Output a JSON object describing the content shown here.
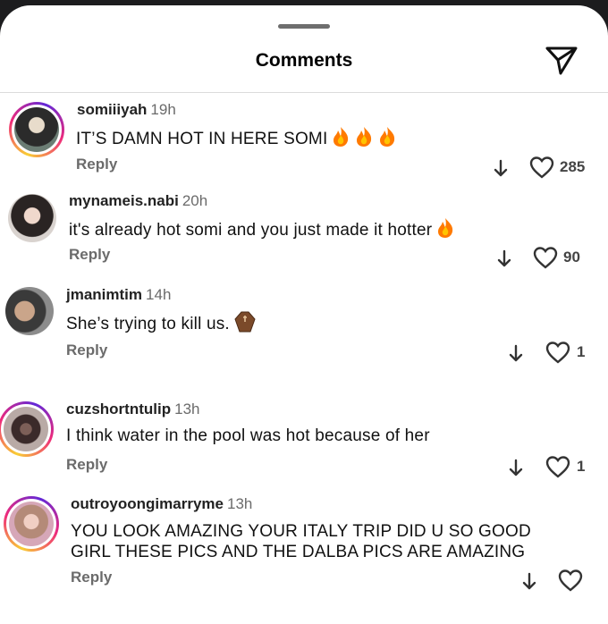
{
  "header": {
    "title": "Comments"
  },
  "comments": [
    {
      "username": "somiiiyah",
      "time": "19h",
      "text": "IT’S DAMN HOT IN HERE SOMI",
      "emoji": "fire-x3",
      "reply_label": "Reply",
      "likes": "285"
    },
    {
      "username": "mynameis.nabi",
      "time": "20h",
      "text": "it's already hot somi and you just made it hotter",
      "emoji": "fire",
      "reply_label": "Reply",
      "likes": "90"
    },
    {
      "username": "jmanimtim",
      "time": "14h",
      "text": "She’s trying to kill us.",
      "emoji": "coffin",
      "reply_label": "Reply",
      "likes": "1"
    },
    {
      "username": "cuzshortntulip",
      "time": "13h",
      "text": "I think water in the pool was hot because of her",
      "reply_label": "Reply",
      "likes": "1"
    },
    {
      "username": "outroyoongimarryme",
      "time": "13h",
      "text_line1": "YOU LOOK AMAZING YOUR ITALY TRIP DID U SO GOOD",
      "text_line2": "GIRL THESE PICS AND THE DALBA PICS ARE AMAZING",
      "reply_label": "Reply",
      "likes": ""
    }
  ],
  "icons": {
    "share": "paper-plane-icon",
    "like": "heart-outline-icon",
    "more_replies": "arrow-down-icon"
  },
  "colors": {
    "background": "#ffffff",
    "secondary_text": "#6b6b6b",
    "fire": "#ff7a00"
  }
}
